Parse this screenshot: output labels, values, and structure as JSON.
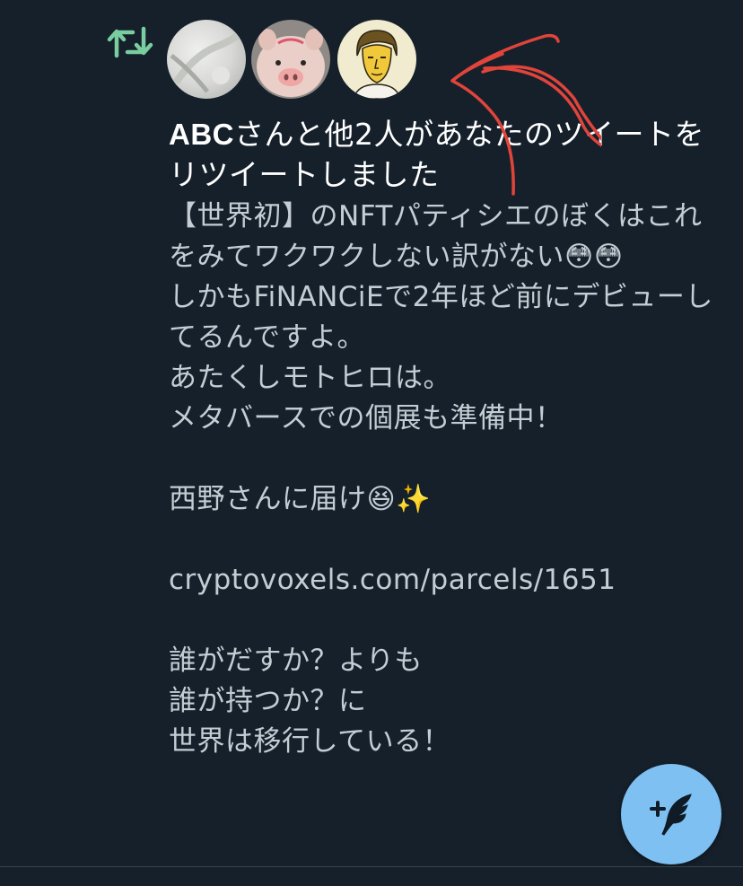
{
  "theme": {
    "background": "#15202b",
    "headline_color": "#ffffff",
    "body_color": "#c5cdd4",
    "retweet_icon_color": "#79cd9f",
    "fab_color": "#7ec0f2",
    "annotation_color": "#e0443a"
  },
  "notification": {
    "icon": "retweet-icon",
    "avatars": [
      {
        "icon": "avatar-blurred-photo"
      },
      {
        "icon": "avatar-pig-photo"
      },
      {
        "icon": "avatar-cartoon-man"
      }
    ],
    "headline": {
      "user_name": "ABC",
      "rest": "さんと他2人があなたのツイートをリツイートしました"
    },
    "tweet_text": "【世界初】のNFTパティシエのぼくはこれをみてワクワクしない訳がない😳😳\nしかもFiNANCiEで2年ほど前にデビューしてるんですよ。\nあたくしモトヒロは。\nメタバースでの個展も準備中！\n\n西野さんに届け😆✨\n\ncryptovoxels.com/parcels/1651\n\n誰がだすか？よりも\n誰が持つか？に\n世界は移行している！"
  },
  "fab": {
    "icon": "compose-tweet-icon"
  },
  "annotation": {
    "icon": "red-hand-drawn-arrow-icon"
  }
}
